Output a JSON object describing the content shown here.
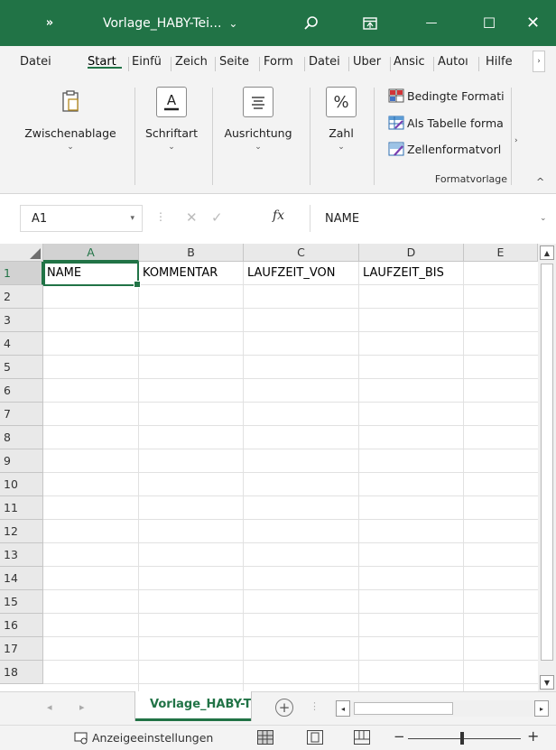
{
  "titlebar": {
    "chevron": "»",
    "title": "Vorlage_HABY-Tei...",
    "title_caret": "⌄",
    "search_icon": "search-icon",
    "ribbon_display_icon": "ribbon-display-icon",
    "minimize": "—",
    "maximize": "☐",
    "close": "✕",
    "color": "#217346"
  },
  "tabs": {
    "items": [
      "Datei",
      "Start",
      "Einfü",
      "Zeich",
      "Seite",
      "Form",
      "Datei",
      "Über",
      "Ansic",
      "Autoı",
      "Hilfe"
    ],
    "active": "Start",
    "scroll": "›"
  },
  "ribbon": {
    "groups": [
      {
        "label": "Zwischenablage",
        "icon": "clipboard-icon",
        "caret": "⌄"
      },
      {
        "label": "Schriftart",
        "icon": "font-icon",
        "caret": "⌄"
      },
      {
        "label": "Ausrichtung",
        "icon": "align-icon",
        "caret": "⌄"
      },
      {
        "label": "Zahl",
        "icon": "percent-icon",
        "symbol": "%",
        "caret": "⌄"
      }
    ],
    "styles": {
      "items": [
        "Bedingte Formati",
        "Als Tabelle forma",
        "Zellenformatvorl"
      ],
      "label": "Formatvorlage",
      "expand": "›",
      "collapse": "^"
    }
  },
  "formula_bar": {
    "name_box": "A1",
    "name_caret": "▾",
    "dots": "⋮",
    "cancel": "✕",
    "enter": "✓",
    "fx": "fx",
    "value": "NAME",
    "expand": "⌄"
  },
  "sheet": {
    "columns": [
      "A",
      "B",
      "C",
      "D",
      "E"
    ],
    "rows": [
      "1",
      "2",
      "3",
      "4",
      "5",
      "6",
      "7",
      "8",
      "9",
      "10",
      "11",
      "12",
      "13",
      "14",
      "15",
      "16",
      "17",
      "18"
    ],
    "row1": [
      "NAME",
      "KOMMENTAR",
      "LAUFZEIT_VON",
      "LAUFZEIT_BIS",
      ""
    ],
    "active_cell": "A1",
    "scroll_up": "▲",
    "scroll_down": "▼"
  },
  "sheet_tabs": {
    "prev": "◂",
    "next": "▸",
    "active_tab": "Vorlage_HABY-T",
    "add": "+",
    "dots": "⋮",
    "hscroll_left": "◂",
    "hscroll_right": "▸"
  },
  "status": {
    "display_settings": "Anzeigeeinstellungen",
    "zoom_minus": "−",
    "zoom_plus": "+",
    "zoom_fraction": 0.48
  }
}
